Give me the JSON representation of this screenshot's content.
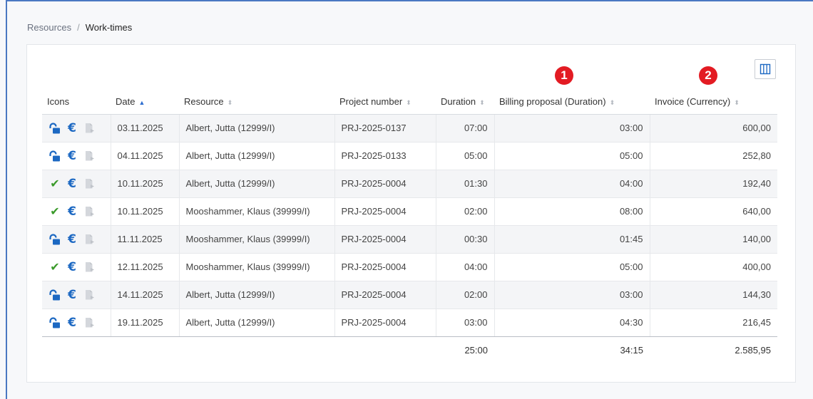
{
  "breadcrumb": {
    "parent": "Resources",
    "separator": "/",
    "current": "Work-times"
  },
  "markers": {
    "one": "1",
    "two": "2"
  },
  "table": {
    "headers": {
      "icons": "Icons",
      "date": "Date",
      "resource": "Resource",
      "project": "Project number",
      "duration": "Duration",
      "billing": "Billing proposal (Duration)",
      "invoice": "Invoice (Currency)"
    },
    "sort": {
      "date": "ascending"
    },
    "rows": [
      {
        "status": "unlocked",
        "date": "03.11.2025",
        "resource": "Albert, Jutta (12999/I)",
        "project": "PRJ-2025-0137",
        "duration": "07:00",
        "billing": "03:00",
        "invoice": "600,00"
      },
      {
        "status": "unlocked",
        "date": "04.11.2025",
        "resource": "Albert, Jutta (12999/I)",
        "project": "PRJ-2025-0133",
        "duration": "05:00",
        "billing": "05:00",
        "invoice": "252,80"
      },
      {
        "status": "approved",
        "date": "10.11.2025",
        "resource": "Albert, Jutta (12999/I)",
        "project": "PRJ-2025-0004",
        "duration": "01:30",
        "billing": "04:00",
        "invoice": "192,40"
      },
      {
        "status": "approved",
        "date": "10.11.2025",
        "resource": "Mooshammer, Klaus (39999/I)",
        "project": "PRJ-2025-0004",
        "duration": "02:00",
        "billing": "08:00",
        "invoice": "640,00"
      },
      {
        "status": "unlocked",
        "date": "11.11.2025",
        "resource": "Mooshammer, Klaus (39999/I)",
        "project": "PRJ-2025-0004",
        "duration": "00:30",
        "billing": "01:45",
        "invoice": "140,00"
      },
      {
        "status": "approved",
        "date": "12.11.2025",
        "resource": "Mooshammer, Klaus (39999/I)",
        "project": "PRJ-2025-0004",
        "duration": "04:00",
        "billing": "05:00",
        "invoice": "400,00"
      },
      {
        "status": "unlocked",
        "date": "14.11.2025",
        "resource": "Albert, Jutta (12999/I)",
        "project": "PRJ-2025-0004",
        "duration": "02:00",
        "billing": "03:00",
        "invoice": "144,30"
      },
      {
        "status": "unlocked",
        "date": "19.11.2025",
        "resource": "Albert, Jutta (12999/I)",
        "project": "PRJ-2025-0004",
        "duration": "03:00",
        "billing": "04:30",
        "invoice": "216,45"
      }
    ],
    "totals": {
      "duration": "25:00",
      "billing": "34:15",
      "invoice": "2.585,95"
    }
  },
  "icons": {
    "unlocked": "unlocked-lock-icon",
    "approved": "checkmark-icon",
    "euro": "euro-icon",
    "document": "document-icon",
    "columns": "columns-icon"
  },
  "colors": {
    "accent": "#1c68c2",
    "approved": "#3a9a2a",
    "marker": "#e31b23",
    "frame": "#4a78c2"
  }
}
